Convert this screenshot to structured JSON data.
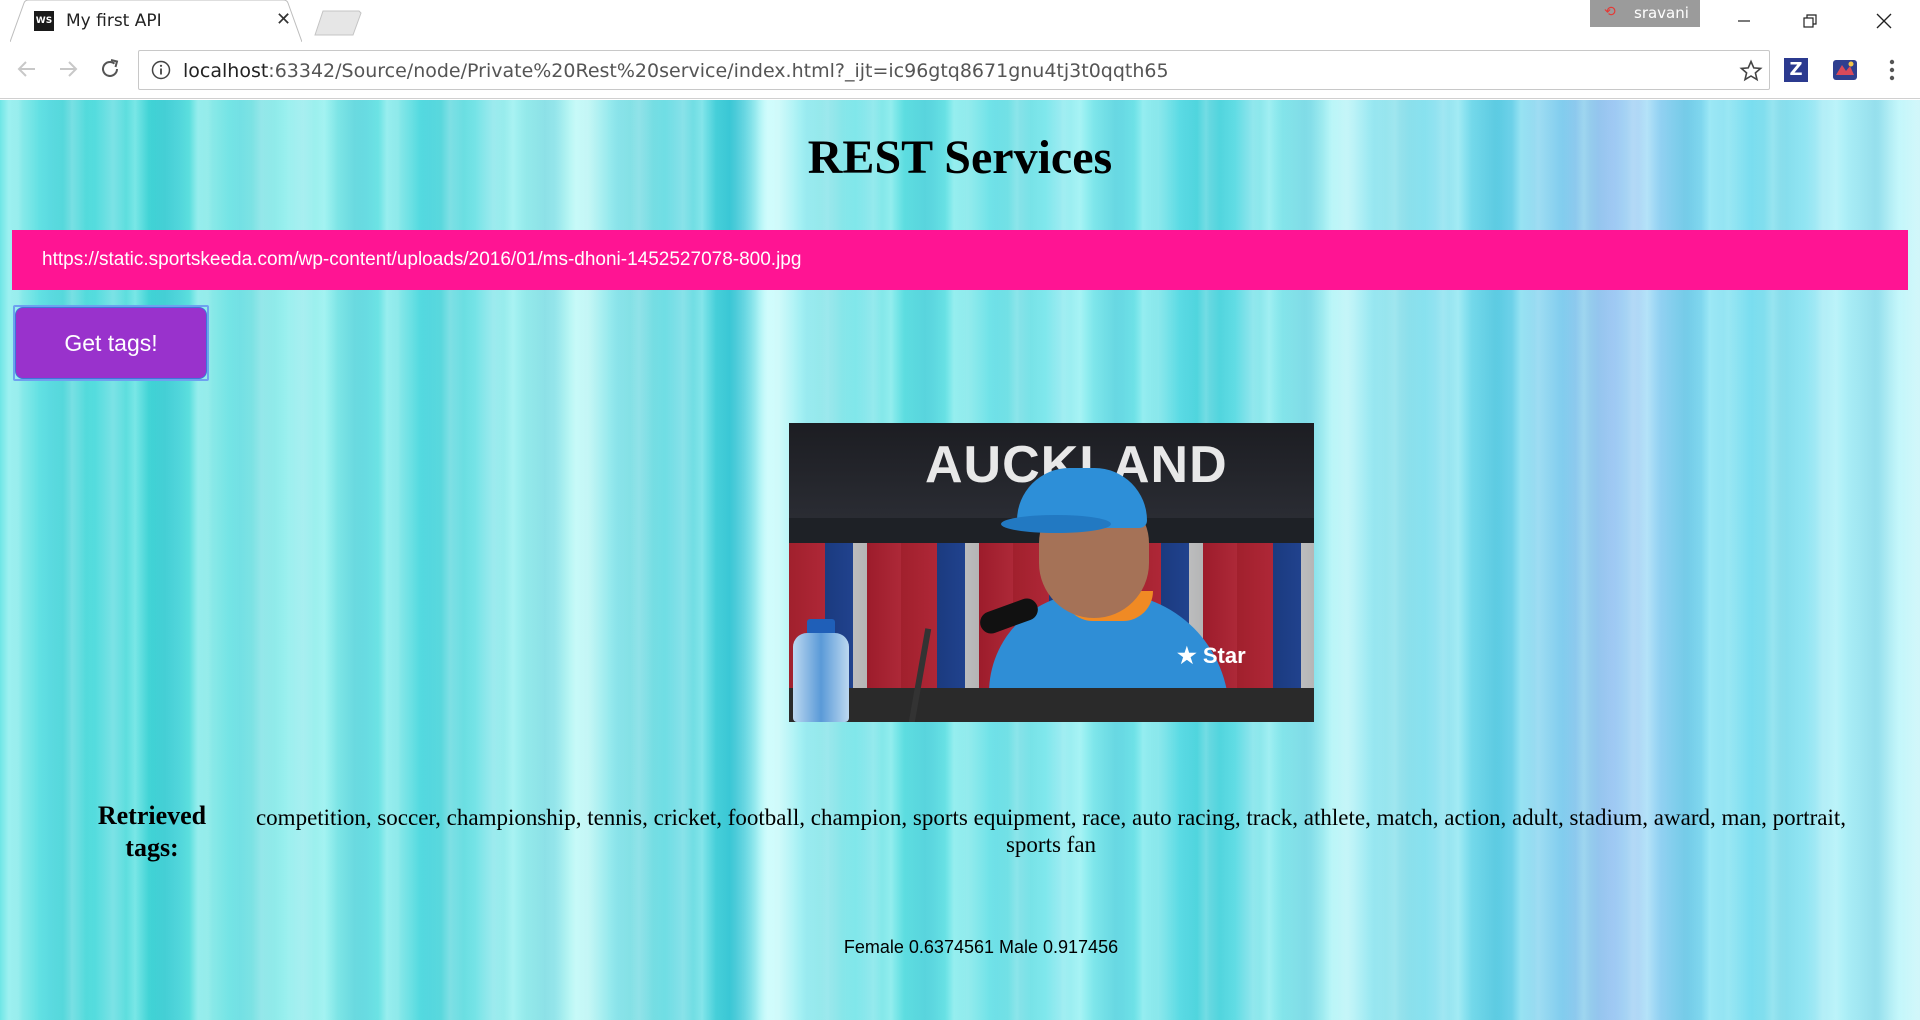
{
  "browser": {
    "tab_title": "My first API",
    "tab_favicon_text": "WS",
    "profile_name": "sravani",
    "address_host": "localhost",
    "address_rest": ":63342/Source/node/Private%20Rest%20service/index.html?_ijt=ic96gtq8671gnu4tj3t0qqth65",
    "extension_z_label": "Z"
  },
  "page": {
    "title": "REST Services",
    "image_url_value": "https://static.sportskeeda.com/wp-content/uploads/2016/01/ms-dhoni-1452527078-800.jpg",
    "get_tags_label": "Get tags!",
    "photo_banner_text": "AUCKLAND",
    "photo_logo_text": "★ Star",
    "tags_label": "Retrieved tags:",
    "tags_text": "competition, soccer, championship, tennis, cricket, football, champion, sports equipment, race, auto racing, track, athlete, match, action, adult, stadium, award, man, portrait, sports fan",
    "gender_text": "Female 0.6374561 Male 0.917456"
  },
  "colors": {
    "url_bar_bg": "#ff1493",
    "button_bg": "#9932cc",
    "page_bg": "#54dcdf"
  },
  "icons": [
    "back-icon",
    "forward-icon",
    "reload-icon",
    "info-icon",
    "star-icon",
    "menu-icon",
    "minimize-icon",
    "restore-icon",
    "close-icon"
  ]
}
